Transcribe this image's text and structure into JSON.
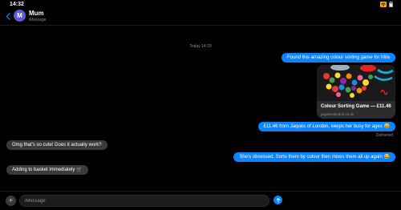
{
  "status_bar": {
    "time": "14:32"
  },
  "header": {
    "avatar_initial": "M",
    "contact_name": "Mum",
    "subtitle": "iMessage"
  },
  "conversation": {
    "timestamp": "Today 14:29",
    "messages": [
      {
        "direction": "outgoing",
        "text": "Found this amazing colour sorting game for Mila"
      },
      {
        "direction": "outgoing",
        "type": "link_preview",
        "title": "Colour Sorting Game — £11.46",
        "domain": "jaquesolondon.co.uk"
      },
      {
        "direction": "outgoing",
        "text": "£11.46 from Jaques of London, keeps her busy for ages 😄"
      },
      {
        "direction": "incoming",
        "text": "Omg that's so cute! Does it actually work?"
      },
      {
        "direction": "outgoing",
        "text": "She's obsessed. Sorts them by colour then mixes them all up again 😂"
      },
      {
        "direction": "incoming",
        "text": "Adding to basket immediately 🛒"
      }
    ],
    "delivered_label": "Delivered"
  },
  "compose": {
    "placeholder": "iMessage"
  },
  "colors": {
    "outgoing_bubble": "#0a84ff",
    "incoming_bubble": "#3a3a3c",
    "background": "#000000",
    "avatar": "#5b5bd6"
  },
  "icons": [
    "wifi-icon",
    "battery-icon",
    "back-chevron-icon",
    "plus-icon",
    "send-arrow-icon"
  ]
}
